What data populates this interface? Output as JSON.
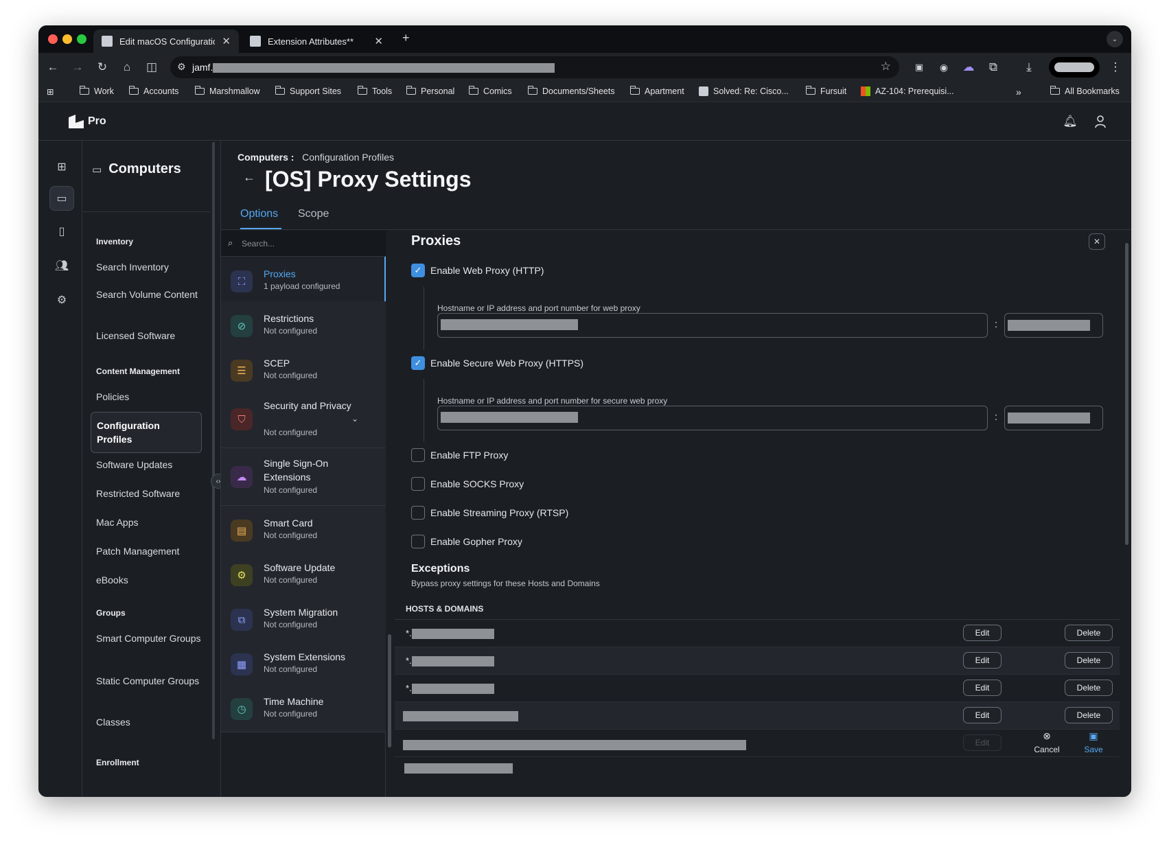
{
  "browser": {
    "tabs": [
      {
        "title": "Edit macOS Configuration Pro",
        "close": "✕"
      },
      {
        "title": "Extension Attributes**",
        "close": "✕"
      }
    ],
    "new_tab": "+",
    "url_prefix": "jamf.",
    "bookmarks": [
      "Work",
      "Accounts",
      "Marshmallow",
      "Support Sites",
      "Tools",
      "Personal",
      "Comics",
      "Documents/Sheets",
      "Apartment",
      "Solved: Re: Cisco...",
      "Fursuit",
      "AZ-104: Prerequisi..."
    ],
    "overflow": "»",
    "all_bookmarks": "All Bookmarks"
  },
  "app": {
    "logo_text": "Pro"
  },
  "sidebar": {
    "title": "Computers",
    "groups": {
      "inventory": "Inventory",
      "content": "Content Management",
      "groups": "Groups",
      "enrollment": "Enrollment"
    },
    "items": {
      "search_inventory": "Search Inventory",
      "search_volume": "Search Volume Content",
      "licensed_software": "Licensed Software",
      "policies": "Policies",
      "config_profiles": "Configuration Profiles",
      "software_updates": "Software Updates",
      "restricted_software": "Restricted Software",
      "mac_apps": "Mac Apps",
      "patch_management": "Patch Management",
      "ebooks": "eBooks",
      "smart_groups": "Smart Computer Groups",
      "static_groups": "Static Computer Groups",
      "classes": "Classes"
    }
  },
  "main": {
    "breadcrumb_root": "Computers",
    "breadcrumb_sep": ":",
    "breadcrumb_current": "Configuration Profiles",
    "title": "[OS] Proxy Settings",
    "tabs": {
      "options": "Options",
      "scope": "Scope"
    }
  },
  "payloads": {
    "search_placeholder": "Search...",
    "items": [
      {
        "name": "Proxies",
        "status": "1 payload configured"
      },
      {
        "name": "Restrictions",
        "status": "Not configured"
      },
      {
        "name": "SCEP",
        "status": "Not configured"
      },
      {
        "name": "Security and Privacy",
        "status": "Not configured"
      },
      {
        "name": "Single Sign-On Extensions",
        "status": "Not configured"
      },
      {
        "name": "Smart Card",
        "status": "Not configured"
      },
      {
        "name": "Software Update",
        "status": "Not configured"
      },
      {
        "name": "System Migration",
        "status": "Not configured"
      },
      {
        "name": "System Extensions",
        "status": "Not configured"
      },
      {
        "name": "Time Machine",
        "status": "Not configured"
      }
    ]
  },
  "proxies": {
    "title": "Proxies",
    "web_proxy": {
      "label": "Enable Web Proxy (HTTP)",
      "checked": true,
      "field_label": "Hostname or IP address and port number for web proxy"
    },
    "secure_proxy": {
      "label": "Enable Secure Web Proxy (HTTPS)",
      "checked": true,
      "field_label": "Hostname or IP address and port number for secure web proxy"
    },
    "colon": ":",
    "ftp": "Enable FTP Proxy",
    "socks": "Enable SOCKS Proxy",
    "rtsp": "Enable Streaming Proxy (RTSP)",
    "gopher": "Enable Gopher Proxy",
    "exceptions_title": "Exceptions",
    "exceptions_sub": "Bypass proxy settings for these Hosts and Domains",
    "hosts_header": "HOSTS & DOMAINS",
    "host_prefix": "*.",
    "edit": "Edit",
    "delete": "Delete"
  },
  "actions": {
    "cancel": "Cancel",
    "save": "Save"
  },
  "colors": {
    "accent": "#56a8f2",
    "checkbox": "#3f8fe0",
    "background": "#1b1f24"
  }
}
